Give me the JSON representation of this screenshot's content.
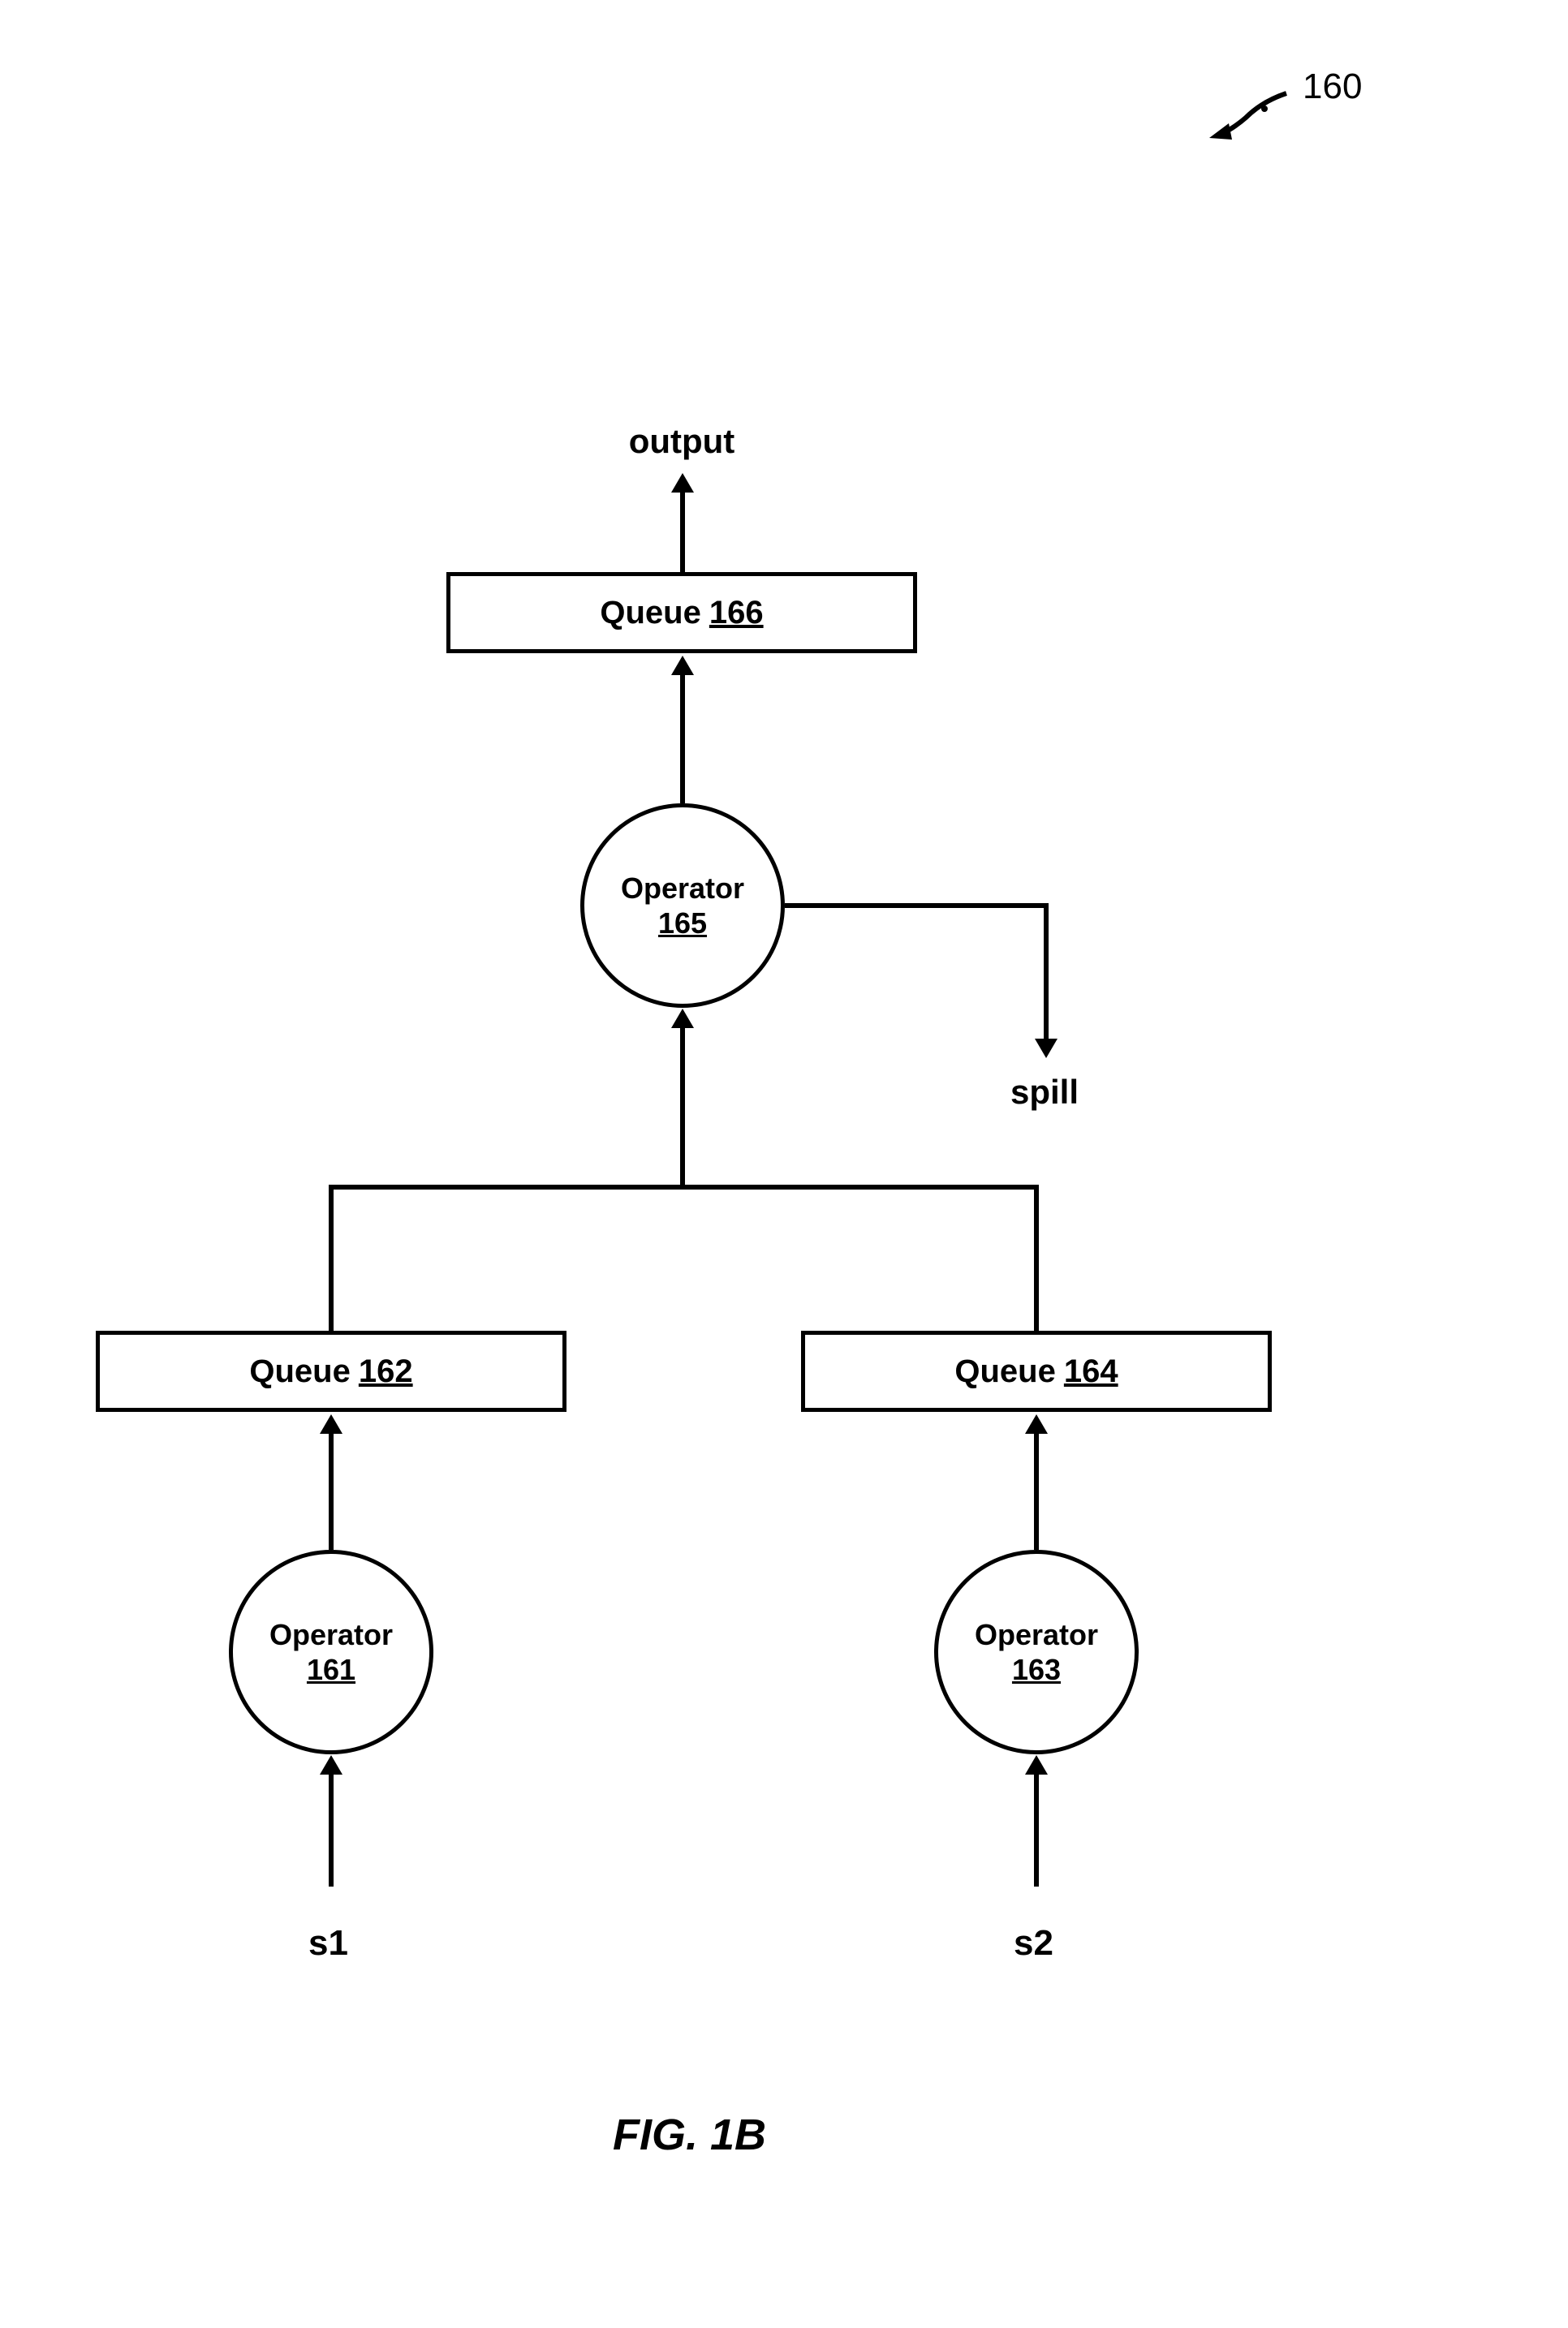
{
  "figureRef": "160",
  "outputLabel": "output",
  "spillLabel": "spill",
  "s1Label": "s1",
  "s2Label": "s2",
  "queue166": {
    "name": "Queue",
    "num": "166"
  },
  "queue162": {
    "name": "Queue",
    "num": "162"
  },
  "queue164": {
    "name": "Queue",
    "num": "164"
  },
  "operator165": {
    "name": "Operator",
    "num": "165"
  },
  "operator161": {
    "name": "Operator",
    "num": "161"
  },
  "operator163": {
    "name": "Operator",
    "num": "163"
  },
  "figureCaption": "FIG. 1B"
}
